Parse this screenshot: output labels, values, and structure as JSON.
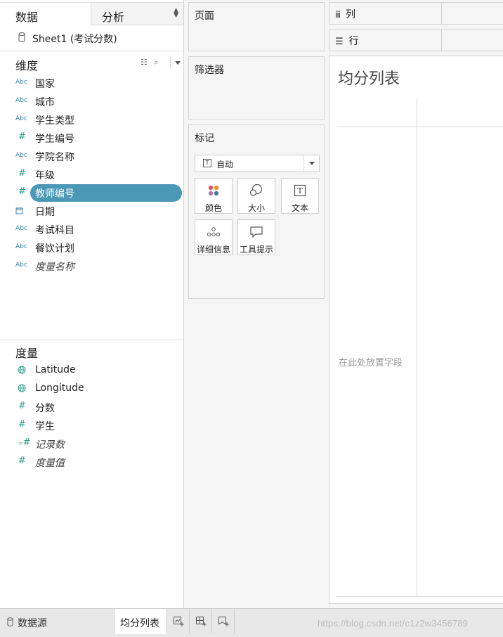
{
  "data_pane": {
    "tab_data": "数据",
    "tab_analysis": "分析",
    "datasource": "Sheet1 (考试分数)",
    "dimensions_title": "维度",
    "dimensions": [
      {
        "type": "Abc",
        "name": "国家"
      },
      {
        "type": "Abc",
        "name": "城市"
      },
      {
        "type": "Abc",
        "name": "学生类型"
      },
      {
        "type": "#",
        "name": "学生编号"
      },
      {
        "type": "Abc",
        "name": "学院名称"
      },
      {
        "type": "#",
        "name": "年级"
      },
      {
        "type": "#",
        "name": "教师编号"
      },
      {
        "type": "date",
        "name": "日期"
      },
      {
        "type": "Abc",
        "name": "考试科目"
      },
      {
        "type": "Abc",
        "name": "餐饮计划"
      },
      {
        "type": "Abc",
        "name": "度量名称"
      }
    ],
    "measures_title": "度量",
    "measures": [
      {
        "type": "geo",
        "name": "Latitude"
      },
      {
        "type": "geo",
        "name": "Longitude"
      },
      {
        "type": "#",
        "name": "分数"
      },
      {
        "type": "#",
        "name": "学生"
      },
      {
        "type": "=#",
        "name": "记录数"
      },
      {
        "type": "#",
        "name": "度量值"
      }
    ],
    "selected_field": "教师编号"
  },
  "cards": {
    "pages": "页面",
    "filters": "筛选器",
    "marks": "标记",
    "mark_type": "自动",
    "mark_buttons": [
      "颜色",
      "大小",
      "文本",
      "详细信息",
      "工具提示"
    ]
  },
  "shelves": {
    "columns_icon": "iii",
    "columns": "列",
    "rows": "行"
  },
  "view": {
    "title": "均分列表",
    "drop_hint": "在此处放置字段"
  },
  "bottom": {
    "datasource_tab": "数据源",
    "sheet_tab": "均分列表",
    "watermark": "https://blog.csdn.net/c1z2w3456789"
  },
  "colors": {
    "selected_pill": "#4a97b6",
    "dimension_icon": "#3b7fa8",
    "measure_icon": "#2f9d8a"
  }
}
